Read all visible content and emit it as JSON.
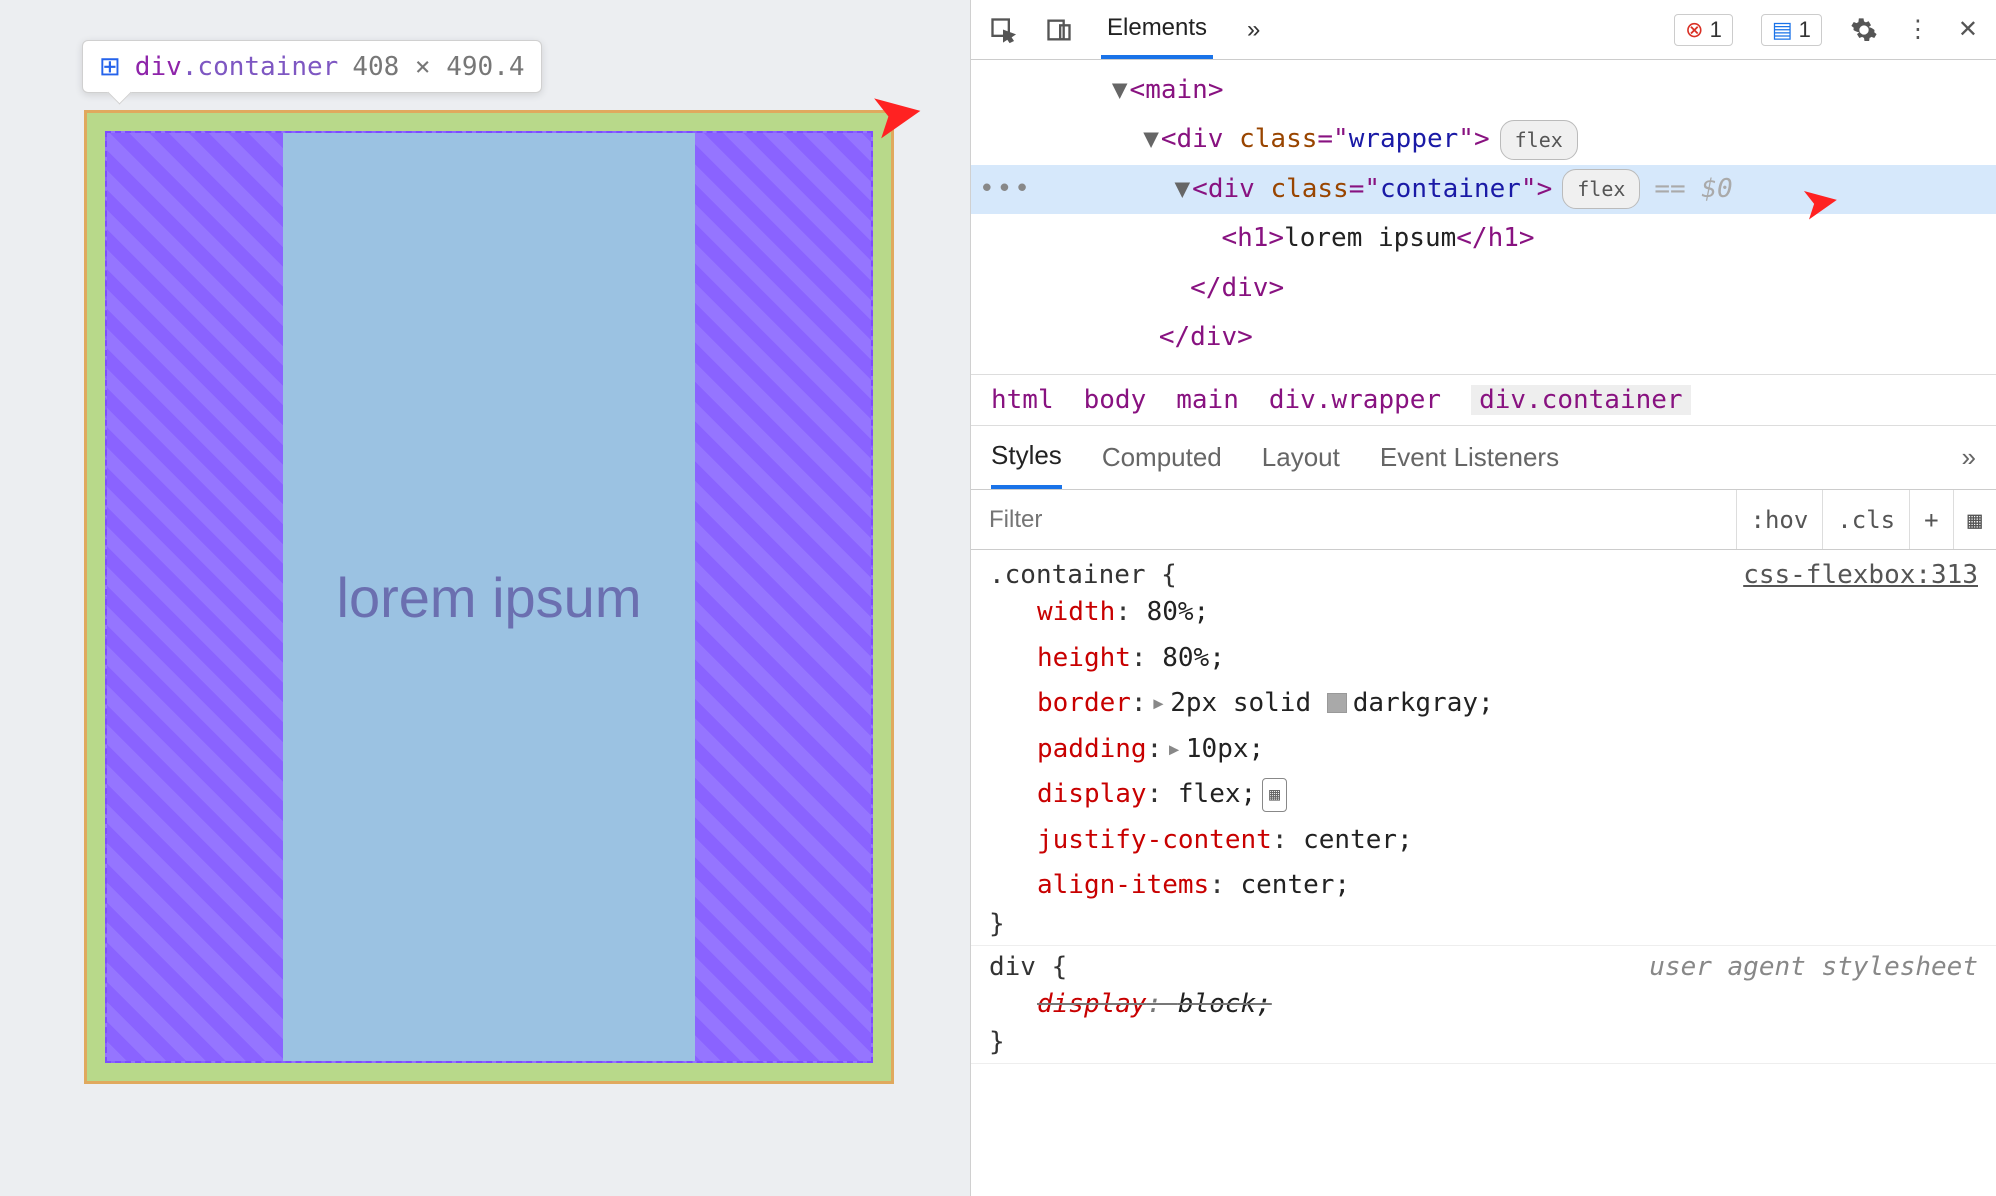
{
  "tooltip": {
    "flex_icon": "⊞",
    "tag": "div",
    "selector": ".container",
    "dimensions": "408 × 490.4"
  },
  "preview": {
    "heading": "lorem ipsum"
  },
  "toolbar": {
    "tab_elements": "Elements",
    "more": "»",
    "err_count": "1",
    "info_count": "1"
  },
  "dom": {
    "main_open": "<main>",
    "wrapper_open": "<div class=\"wrapper\">",
    "container_open": "<div class=\"container\">",
    "flex_badge": "flex",
    "eq0": "== $0",
    "h1_line": "<h1>lorem ipsum</h1>",
    "div_close1": "</div>",
    "div_close2": "</div>"
  },
  "crumbs": [
    "html",
    "body",
    "main",
    "div.wrapper",
    "div.container"
  ],
  "subtabs": {
    "styles": "Styles",
    "computed": "Computed",
    "layout": "Layout",
    "listeners": "Event Listeners",
    "more": "»"
  },
  "filter": {
    "placeholder": "Filter",
    "hov": ":hov",
    "cls": ".cls",
    "plus": "+"
  },
  "rules": {
    "container": {
      "selector": ".container {",
      "source": "css-flexbox:313",
      "decls": [
        {
          "prop": "width",
          "val": "80%;"
        },
        {
          "prop": "height",
          "val": "80%;"
        },
        {
          "prop": "border",
          "val": "2px solid  darkgray;",
          "expand": true,
          "swatch": true
        },
        {
          "prop": "padding",
          "val": "10px;",
          "expand": true
        },
        {
          "prop": "display",
          "val": "flex;",
          "grid": true
        },
        {
          "prop": "justify-content",
          "val": "center;"
        },
        {
          "prop": "align-items",
          "val": "center;"
        }
      ],
      "close": "}"
    },
    "div": {
      "selector": "div {",
      "source": "user agent stylesheet",
      "decls": [
        {
          "prop": "display",
          "val": "block;",
          "strike": true
        }
      ],
      "close": "}"
    }
  }
}
